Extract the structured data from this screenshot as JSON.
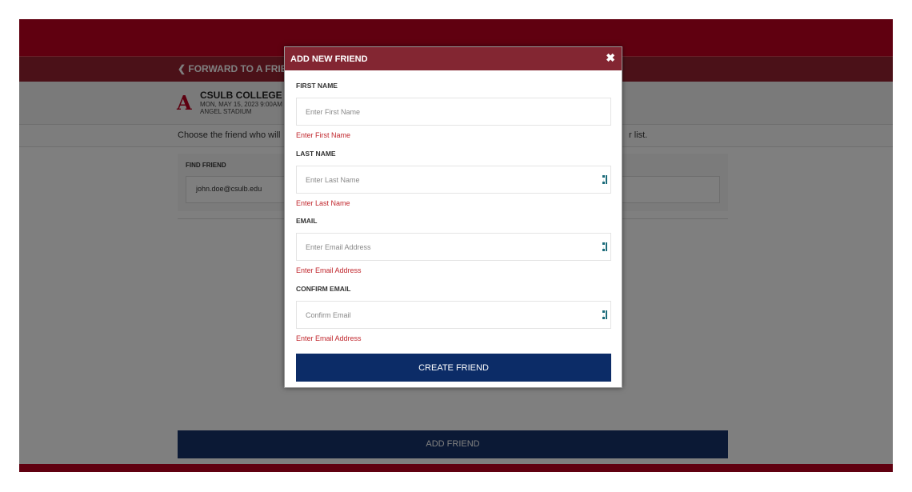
{
  "page": {
    "back_label": "FORWARD TO A FRIEND",
    "event": {
      "title": "CSULB COLLEGE OF",
      "date": "MON, MAY 15, 2023 9:00AM",
      "venue": "ANGEL STADIUM",
      "logo": "A"
    },
    "instruction_left": "Choose the friend who will",
    "instruction_right": "r list.",
    "find_friend": {
      "label": "FIND FRIEND",
      "value": "john.doe@csulb.edu"
    },
    "add_friend_label": "ADD FRIEND"
  },
  "modal": {
    "title": "ADD NEW FRIEND",
    "close_icon": "close-icon",
    "fields": [
      {
        "label": "FIRST NAME",
        "placeholder": "Enter First Name",
        "error": "Enter First Name"
      },
      {
        "label": "LAST NAME",
        "placeholder": "Enter Last Name",
        "error": "Enter Last Name"
      },
      {
        "label": "EMAIL",
        "placeholder": "Enter Email Address",
        "error": "Enter Email Address"
      },
      {
        "label": "CONFIRM EMAIL",
        "placeholder": "Confirm Email",
        "error": "Enter Email Address"
      }
    ],
    "submit_label": "CREATE FRIEND"
  },
  "colors": {
    "brand_red": "#c00021",
    "modal_header": "#832632",
    "button_navy": "#0c2c67",
    "error": "#c0262c"
  }
}
